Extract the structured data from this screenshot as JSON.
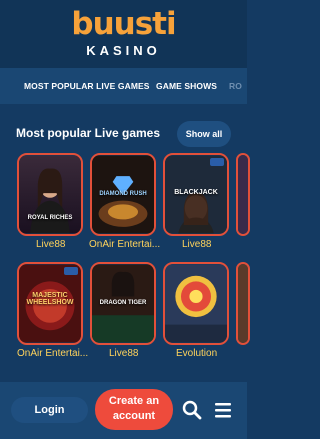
{
  "header": {
    "logo": "buusti",
    "logo_sub": "KASINO"
  },
  "categories": [
    "MOST POPULAR LIVE GAMES",
    "GAME SHOWS",
    "RO"
  ],
  "section": {
    "title": "Most popular Live games",
    "show_all": "Show all"
  },
  "games": [
    {
      "caption": "ROYAL RICHES",
      "provider": "Live88"
    },
    {
      "caption": "DIAMOND RUSH",
      "provider": "OnAir Entertai..."
    },
    {
      "caption": "BLACKJACK",
      "provider": "Live88"
    },
    {
      "caption": "MAJESTIC WHEELSHOW",
      "provider": "OnAir Entertai..."
    },
    {
      "caption": "DRAGON TIGER",
      "provider": "Live88"
    },
    {
      "caption": "",
      "provider": "Evolution"
    }
  ],
  "bottom": {
    "login": "Login",
    "create_line1": "Create an",
    "create_line2": "account"
  },
  "icons": {
    "search": "search-icon",
    "menu": "menu-icon"
  },
  "colors": {
    "bg": "#143a62",
    "accent": "#ee4b3c",
    "provider": "#ffd35c"
  }
}
